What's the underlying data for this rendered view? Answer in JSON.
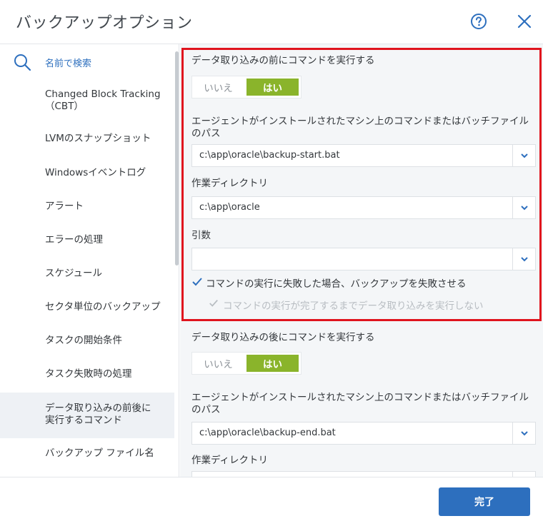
{
  "dialog": {
    "title": "バックアップオプション",
    "done_label": "完了",
    "colors": {
      "accent": "#2d6fbe",
      "toggle_on": "#8ab42b",
      "highlight": "#e0141e"
    }
  },
  "sidebar": {
    "search_label": "名前で検索",
    "items": [
      {
        "label": "Changed Block Tracking（CBT）"
      },
      {
        "label": "LVMのスナップショット"
      },
      {
        "label": "Windowsイベントログ"
      },
      {
        "label": "アラート"
      },
      {
        "label": "エラーの処理"
      },
      {
        "label": "スケジュール"
      },
      {
        "label": "セクタ単位のバックアップ"
      },
      {
        "label": "タスクの開始条件"
      },
      {
        "label": "タスク失敗時の処理"
      },
      {
        "label": "データ取り込みの前後に実行するコマンド"
      },
      {
        "label": "バックアップ ファイル名"
      }
    ]
  },
  "pre": {
    "heading": "データ取り込みの前にコマンドを実行する",
    "toggle_no": "いいえ",
    "toggle_yes": "はい",
    "cmd_label": "エージェントがインストールされたマシン上のコマンドまたはバッチファイルのパス",
    "cmd_value": "c:\\app\\oracle\\backup-start.bat",
    "dir_label": "作業ディレクトリ",
    "dir_value": "c:\\app\\oracle",
    "args_label": "引数",
    "args_value": "",
    "fail_check_label": "コマンドの実行に失敗した場合、バックアップを失敗させる",
    "wait_check_label": "コマンドの実行が完了するまでデータ取り込みを実行しない"
  },
  "post": {
    "heading": "データ取り込みの後にコマンドを実行する",
    "toggle_no": "いいえ",
    "toggle_yes": "はい",
    "cmd_label": "エージェントがインストールされたマシン上のコマンドまたはバッチファイルのパス",
    "cmd_value": "c:\\app\\oracle\\backup-end.bat",
    "dir_label": "作業ディレクトリ"
  }
}
